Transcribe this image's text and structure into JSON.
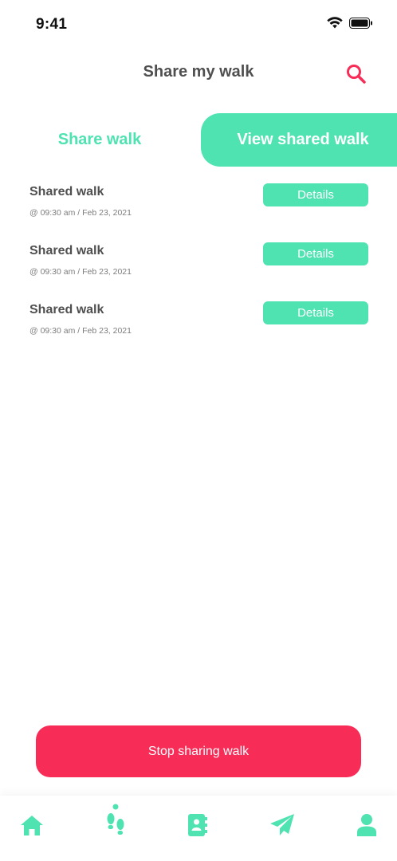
{
  "status_bar": {
    "time": "9:41"
  },
  "header": {
    "title": "Share my walk",
    "search_icon": "search-icon"
  },
  "tabs": [
    {
      "label": "Share walk",
      "selected": false
    },
    {
      "label": "View shared walk",
      "selected": true
    }
  ],
  "walks": [
    {
      "title": "Shared walk",
      "time": "@ 09:30 am / Feb 23, 2021",
      "button": "Details"
    },
    {
      "title": "Shared walk",
      "time": "@ 09:30 am / Feb 23, 2021",
      "button": "Details"
    },
    {
      "title": "Shared walk",
      "time": "@ 09:30 am / Feb 23, 2021",
      "button": "Details"
    }
  ],
  "stop_button": "Stop sharing walk",
  "bottom_nav": [
    "home-icon",
    "footsteps-icon",
    "contacts-icon",
    "send-icon",
    "profile-icon"
  ],
  "colors": {
    "accent": "#4fe3b1",
    "danger": "#f72c57",
    "text": "#4f4f4f"
  }
}
